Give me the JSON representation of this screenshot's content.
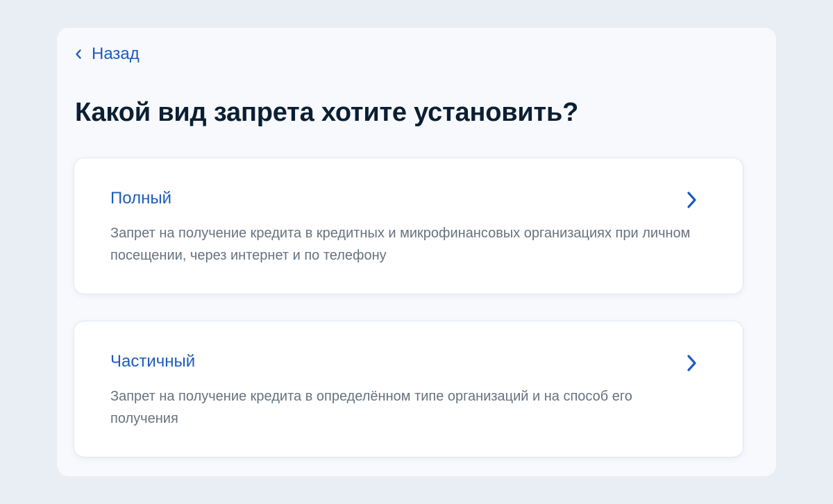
{
  "nav": {
    "back_label": "Назад",
    "back_icon": "chevron-left-icon"
  },
  "page": {
    "title": "Какой вид запрета хотите установить?"
  },
  "options": [
    {
      "title": "Полный",
      "description": "Запрет на получение кредита в кредитных и микрофинансовых организациях при личном посещении, через интернет и по телефону",
      "icon": "chevron-right-icon"
    },
    {
      "title": "Частичный",
      "description": "Запрет на получение кредита в определённом типе организаций и на способ его получения",
      "icon": "chevron-right-icon"
    }
  ],
  "colors": {
    "background": "#e9eef5",
    "panel": "#f7f9fc",
    "accent": "#1d5bbf",
    "title": "#0b1f33",
    "muted_text": "#66727f"
  }
}
